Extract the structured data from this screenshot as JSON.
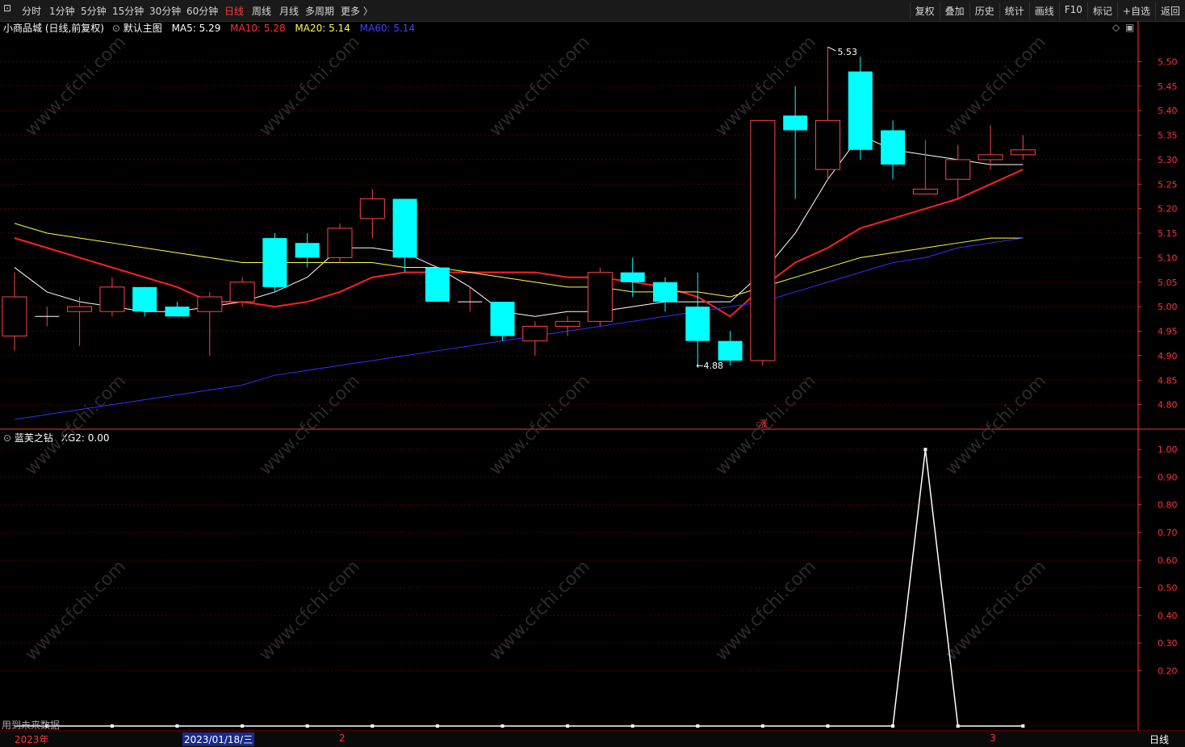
{
  "toolbar": {
    "periods": [
      "分时",
      "1分钟",
      "5分钟",
      "15分钟",
      "30分钟",
      "60分钟",
      "日线",
      "周线",
      "月线",
      "多周期",
      "更多 〉"
    ],
    "active_period": "日线",
    "right_buttons": [
      "复权",
      "叠加",
      "历史",
      "统计",
      "画线",
      "F10",
      "标记",
      "+自选",
      "返回"
    ]
  },
  "main_legend": {
    "stock": "小商品城 (日线,前复权)",
    "template": "默认主图",
    "ma5": "MA5: 5.29",
    "ma10": "MA10: 5.28",
    "ma20": "MA20: 5.14",
    "ma60": "MA60: 5.14"
  },
  "indicator_legend": {
    "name": "蓝芙之钻",
    "value": "XG2: 0.00"
  },
  "notes": {
    "future_data": "用到未来数据",
    "limit_up": "涨"
  },
  "bottom": {
    "year": "2023年",
    "date": "2023/01/18/三",
    "month2": "2",
    "month3": "3",
    "period": "日线"
  },
  "colors": {
    "up": "#ff4444",
    "down": "#00ffff",
    "ma5": "#ffffff",
    "ma10": "#ff2020",
    "ma20": "#ffff44",
    "ma60": "#3030ff",
    "grid": "#5a0000",
    "axis": "#ff3333"
  },
  "watermark": "www.cfchi.com",
  "chart_data": [
    {
      "type": "candlestick",
      "title": "小商品城 (日线,前复权)",
      "ylim": [
        4.75,
        5.56
      ],
      "y_ticks": [
        4.8,
        4.85,
        4.9,
        4.95,
        5.0,
        5.05,
        5.1,
        5.15,
        5.2,
        5.25,
        5.3,
        5.35,
        5.4,
        5.45,
        5.5
      ],
      "annotations": {
        "high": "5.53",
        "low": "4.88"
      },
      "candles": [
        {
          "o": 4.94,
          "h": 5.07,
          "l": 4.91,
          "c": 5.02
        },
        {
          "o": 4.98,
          "h": 5.0,
          "l": 4.96,
          "c": 4.98
        },
        {
          "o": 4.99,
          "h": 5.02,
          "l": 4.92,
          "c": 5.0
        },
        {
          "o": 4.99,
          "h": 5.06,
          "l": 4.98,
          "c": 5.04
        },
        {
          "o": 5.04,
          "h": 5.04,
          "l": 4.98,
          "c": 4.99
        },
        {
          "o": 5.0,
          "h": 5.01,
          "l": 4.98,
          "c": 4.98
        },
        {
          "o": 4.99,
          "h": 5.03,
          "l": 4.9,
          "c": 5.02
        },
        {
          "o": 5.01,
          "h": 5.06,
          "l": 5.0,
          "c": 5.05
        },
        {
          "o": 5.14,
          "h": 5.15,
          "l": 5.03,
          "c": 5.04
        },
        {
          "o": 5.13,
          "h": 5.15,
          "l": 5.08,
          "c": 5.1
        },
        {
          "o": 5.1,
          "h": 5.17,
          "l": 5.09,
          "c": 5.16
        },
        {
          "o": 5.18,
          "h": 5.24,
          "l": 5.14,
          "c": 5.22
        },
        {
          "o": 5.22,
          "h": 5.22,
          "l": 5.07,
          "c": 5.1
        },
        {
          "o": 5.08,
          "h": 5.08,
          "l": 5.01,
          "c": 5.01
        },
        {
          "o": 5.01,
          "h": 5.04,
          "l": 4.99,
          "c": 5.01
        },
        {
          "o": 5.01,
          "h": 5.01,
          "l": 4.93,
          "c": 4.94
        },
        {
          "o": 4.93,
          "h": 4.97,
          "l": 4.9,
          "c": 4.96
        },
        {
          "o": 4.96,
          "h": 4.98,
          "l": 4.94,
          "c": 4.97
        },
        {
          "o": 4.97,
          "h": 5.08,
          "l": 4.96,
          "c": 5.07
        },
        {
          "o": 5.07,
          "h": 5.1,
          "l": 5.02,
          "c": 5.05
        },
        {
          "o": 5.05,
          "h": 5.06,
          "l": 4.99,
          "c": 5.01
        },
        {
          "o": 5.0,
          "h": 5.07,
          "l": 4.88,
          "c": 4.93
        },
        {
          "o": 4.93,
          "h": 4.95,
          "l": 4.88,
          "c": 4.89
        },
        {
          "o": 4.89,
          "h": 5.38,
          "l": 4.88,
          "c": 5.38
        },
        {
          "o": 5.39,
          "h": 5.45,
          "l": 5.22,
          "c": 5.36
        },
        {
          "o": 5.28,
          "h": 5.53,
          "l": 5.26,
          "c": 5.38
        },
        {
          "o": 5.48,
          "h": 5.51,
          "l": 5.3,
          "c": 5.32
        },
        {
          "o": 5.36,
          "h": 5.38,
          "l": 5.26,
          "c": 5.29
        },
        {
          "o": 5.23,
          "h": 5.34,
          "l": 5.23,
          "c": 5.24
        },
        {
          "o": 5.26,
          "h": 5.33,
          "l": 5.22,
          "c": 5.3
        },
        {
          "o": 5.3,
          "h": 5.37,
          "l": 5.28,
          "c": 5.31
        },
        {
          "o": 5.31,
          "h": 5.35,
          "l": 5.3,
          "c": 5.32
        }
      ],
      "series": [
        {
          "name": "MA5",
          "values": [
            5.08,
            5.03,
            5.01,
            5.0,
            4.99,
            4.99,
            5.0,
            5.01,
            5.03,
            5.06,
            5.12,
            5.12,
            5.11,
            5.08,
            5.04,
            4.99,
            4.98,
            4.99,
            4.99,
            5.0,
            5.01,
            5.01,
            5.01,
            5.07,
            5.15,
            5.26,
            5.35,
            5.32,
            5.31,
            5.3,
            5.29,
            5.29
          ]
        },
        {
          "name": "MA10",
          "values": [
            5.14,
            5.12,
            5.1,
            5.08,
            5.06,
            5.04,
            5.01,
            5.01,
            5.0,
            5.01,
            5.03,
            5.06,
            5.07,
            5.07,
            5.07,
            5.07,
            5.07,
            5.06,
            5.06,
            5.05,
            5.04,
            5.02,
            4.98,
            5.04,
            5.09,
            5.12,
            5.16,
            5.18,
            5.2,
            5.22,
            5.25,
            5.28
          ]
        },
        {
          "name": "MA20",
          "values": [
            5.17,
            5.15,
            5.14,
            5.13,
            5.12,
            5.11,
            5.1,
            5.09,
            5.09,
            5.09,
            5.09,
            5.09,
            5.08,
            5.08,
            5.07,
            5.06,
            5.05,
            5.04,
            5.04,
            5.03,
            5.03,
            5.03,
            5.02,
            5.04,
            5.06,
            5.08,
            5.1,
            5.11,
            5.12,
            5.13,
            5.14,
            5.14
          ]
        },
        {
          "name": "MA60",
          "values": [
            4.77,
            4.78,
            4.79,
            4.8,
            4.81,
            4.82,
            4.83,
            4.84,
            4.86,
            4.87,
            4.88,
            4.89,
            4.9,
            4.91,
            4.92,
            4.93,
            4.94,
            4.95,
            4.96,
            4.97,
            4.98,
            4.99,
            5.0,
            5.01,
            5.03,
            5.05,
            5.07,
            5.09,
            5.1,
            5.12,
            5.13,
            5.14
          ]
        }
      ]
    },
    {
      "type": "line",
      "title": "蓝芙之钻",
      "ylim": [
        0,
        1.05
      ],
      "y_ticks": [
        0.2,
        0.3,
        0.4,
        0.5,
        0.6,
        0.7,
        0.8,
        0.9,
        1.0
      ],
      "series": [
        {
          "name": "XG2",
          "values": [
            0,
            0,
            0,
            0,
            0,
            0,
            0,
            0,
            0,
            0,
            0,
            0,
            0,
            0,
            0,
            0,
            0,
            0,
            0,
            0,
            0,
            0,
            0,
            0,
            0,
            0,
            0,
            0,
            1,
            0,
            0,
            0
          ]
        }
      ]
    }
  ]
}
